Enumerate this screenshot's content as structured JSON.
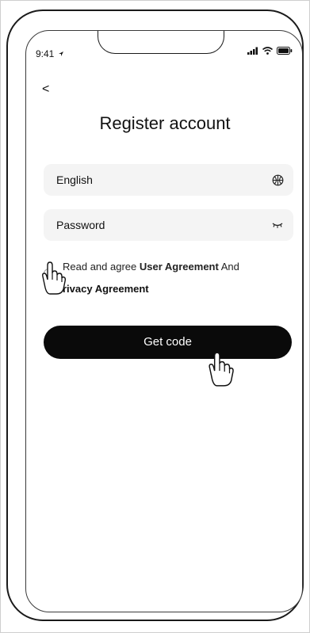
{
  "status_bar": {
    "time": "9:41"
  },
  "header": {
    "back_glyph": "<",
    "title": "Register account"
  },
  "form": {
    "account": {
      "value": "English",
      "icon": "globe-icon"
    },
    "password": {
      "value": "Password",
      "icon": "eye-closed-icon"
    },
    "agreement": {
      "prefix": "Read and agree",
      "user_agreement": "User Agreement",
      "conjunction": "And",
      "privacy_agreement": "rivacy Agreement"
    },
    "submit_label": "Get code"
  },
  "icons": [
    "location-arrow-icon",
    "signal-icon",
    "wifi-icon",
    "battery-icon",
    "hand-cursor-icon"
  ]
}
